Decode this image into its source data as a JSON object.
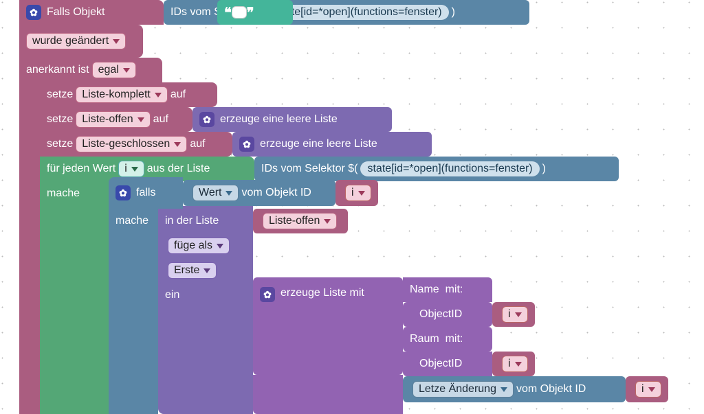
{
  "trigger": {
    "prefix": "Falls Objekt",
    "ids_label": "IDs vom Selektor $(",
    "selector": "state[id=*open](functions=fenster)",
    "close_paren": ")",
    "changed_label": "wurde geändert",
    "ack_label": "anerkannt ist",
    "ack_val": "egal"
  },
  "set1": {
    "set": "setze",
    "var": "Liste-komplett",
    "to": "auf"
  },
  "set2": {
    "set": "setze",
    "var": "Liste-offen",
    "to": "auf",
    "empty": "erzeuge eine leere Liste"
  },
  "set3": {
    "set": "setze",
    "var": "Liste-geschlossen",
    "to": "auf",
    "empty": "erzeuge eine leere Liste"
  },
  "loop": {
    "each": "für jeden Wert",
    "v": "i",
    "from": "aus der Liste",
    "do": "mache"
  },
  "ids2": {
    "label": "IDs vom Selektor $(",
    "selector": "state[id=*open](functions=fenster)",
    "close": ")"
  },
  "if": {
    "word": "falls",
    "val": "Wert",
    "obj": "vom Objekt ID",
    "iv": "i",
    "do": "mache"
  },
  "list_op": {
    "in": "in der Liste",
    "var": "Liste-offen",
    "add": "füge als",
    "first": "Erste",
    "ins": "ein"
  },
  "mklist": {
    "label": "erzeuge Liste mit",
    "row1a": "Name",
    "mit": "mit:",
    "row1b": "ObjectID",
    "iv": "i",
    "row2a": "Raum",
    "row2b": "ObjectID",
    "row3a": "Letze Änderung",
    "row3b": "vom Objekt ID"
  }
}
